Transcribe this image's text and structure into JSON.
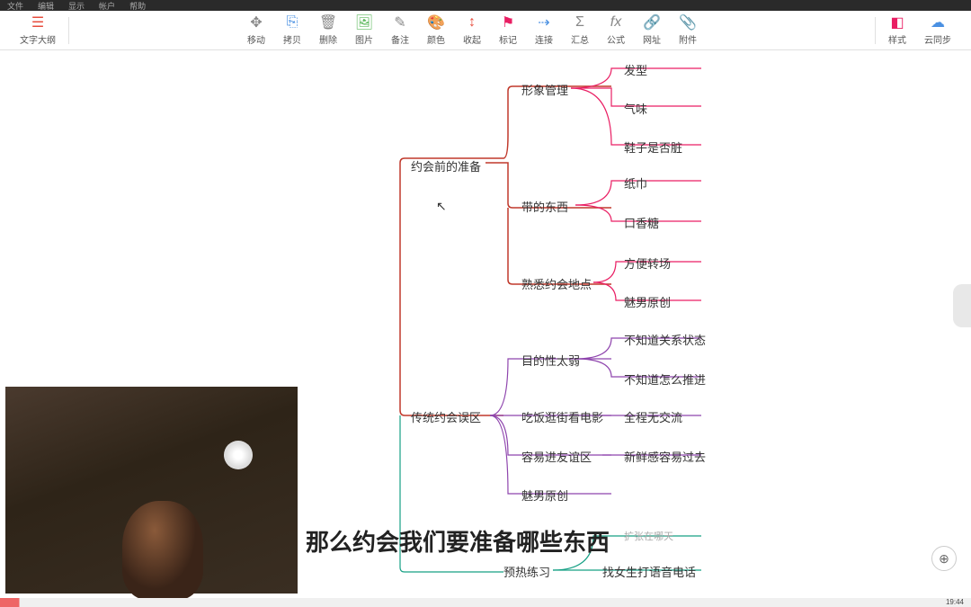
{
  "menu": [
    "文件",
    "编辑",
    "显示",
    "帐户",
    "帮助"
  ],
  "toolbar": {
    "outline": "文字大纲",
    "move": "移动",
    "paste": "拷贝",
    "delete": "删除",
    "image": "图片",
    "note": "备注",
    "color": "颜色",
    "collapse": "收起",
    "marker": "标记",
    "connect": "连接",
    "summary": "汇总",
    "formula": "公式",
    "url": "网址",
    "attach": "附件",
    "style": "样式",
    "sync": "云同步"
  },
  "mindmap": {
    "root": "约会前的准备",
    "b1": {
      "label": "形象管理",
      "children": [
        "发型",
        "气味",
        "鞋子是否脏"
      ]
    },
    "b2": {
      "label": "带的东西",
      "children": [
        "纸巾",
        "口香糖"
      ]
    },
    "b3": {
      "label": "熟悉约会地点",
      "children": [
        "方便转场",
        "魅男原创"
      ]
    },
    "root2": "传统约会误区",
    "b4": {
      "label": "目的性太弱",
      "children": [
        "不知道关系状态",
        "不知道怎么推进"
      ]
    },
    "b5": {
      "label": "吃饭逛街看电影",
      "side": "全程无交流"
    },
    "b6": {
      "label": "容易进友谊区",
      "side": "新鲜感容易过去"
    },
    "b7": {
      "label": "魅男原创"
    },
    "b8": {
      "label": "预热练习",
      "side": "找女生打语音电话",
      "side2": "扩张在哪天"
    }
  },
  "caption": "那么约会我们要准备哪些东西",
  "clock": "19:44"
}
